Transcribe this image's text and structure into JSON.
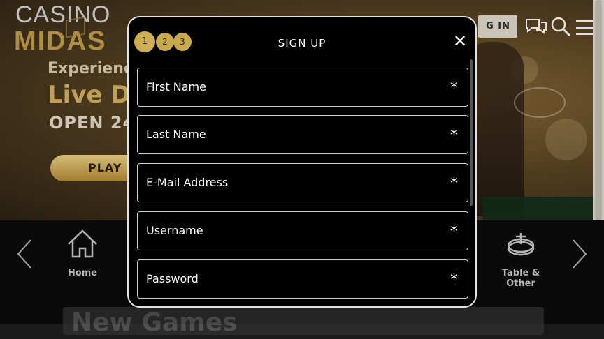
{
  "header": {
    "logo_top": "CASINO",
    "logo_bottom": "MIDAS",
    "login_label": "G IN",
    "chat_icon": "chat-icon",
    "search_icon": "search-icon",
    "menu_icon": "hamburger-menu-icon"
  },
  "hero": {
    "line1": "Experience",
    "line2": "Live De",
    "line3": "OPEN 24",
    "play_label": "PLAY I"
  },
  "categories": {
    "home_label": "Home",
    "table_label": "Table & Other",
    "home_icon": "home-icon",
    "table_icon": "roulette-icon",
    "left_arrow": "chevron-left-icon",
    "right_arrow": "chevron-right-icon"
  },
  "section": {
    "title": "New Games"
  },
  "signup": {
    "title": "SIGN UP",
    "close_icon": "close-icon",
    "steps": [
      "1",
      "2",
      "3"
    ],
    "active_step": 1,
    "fields": [
      {
        "label": "First Name",
        "required": "*"
      },
      {
        "label": "Last Name",
        "required": "*"
      },
      {
        "label": "E-Mail Address",
        "required": "*"
      },
      {
        "label": "Username",
        "required": "*"
      },
      {
        "label": "Password",
        "required": "*"
      }
    ]
  },
  "colors": {
    "accent_gold": "#c9a94e",
    "modal_bg": "#000000",
    "field_border": "#cfcfcf"
  }
}
